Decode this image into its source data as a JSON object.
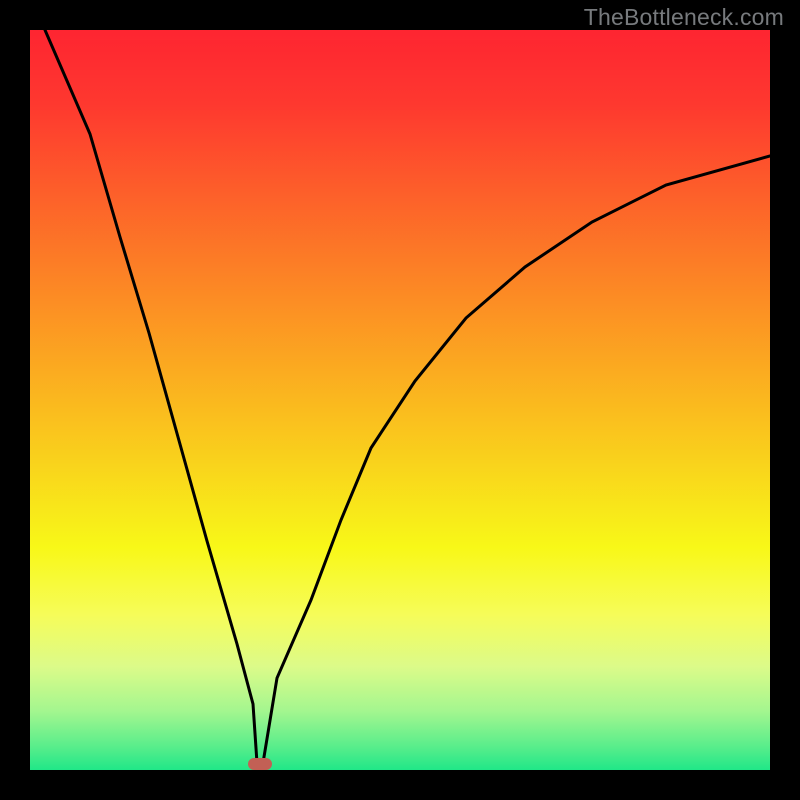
{
  "watermark": "TheBottleneck.com",
  "chart_data": {
    "type": "line",
    "title": "",
    "xlabel": "",
    "ylabel": "",
    "xlim": [
      0,
      100
    ],
    "ylim": [
      0,
      100
    ],
    "grid": false,
    "legend": false,
    "annotations": [
      {
        "kind": "marker",
        "x": 31,
        "y": 0,
        "shape": "rounded-rect",
        "color": "#c26055"
      }
    ],
    "series": [
      {
        "name": "bottleneck-curve",
        "x": [
          2,
          6,
          10,
          14,
          18,
          22,
          26,
          30,
          31,
          33,
          36,
          40,
          45,
          50,
          56,
          63,
          71,
          80,
          90,
          100
        ],
        "y": [
          100,
          86,
          72,
          59,
          45,
          31,
          17,
          3,
          0,
          3,
          12,
          23,
          34,
          44,
          53,
          61,
          68,
          74,
          79,
          83
        ]
      }
    ],
    "background_gradient": {
      "orientation": "vertical",
      "stops": [
        {
          "pos": 0.0,
          "color": "#fe2531"
        },
        {
          "pos": 0.7,
          "color": "#f8f818"
        },
        {
          "pos": 1.0,
          "color": "#20e788"
        }
      ]
    }
  }
}
